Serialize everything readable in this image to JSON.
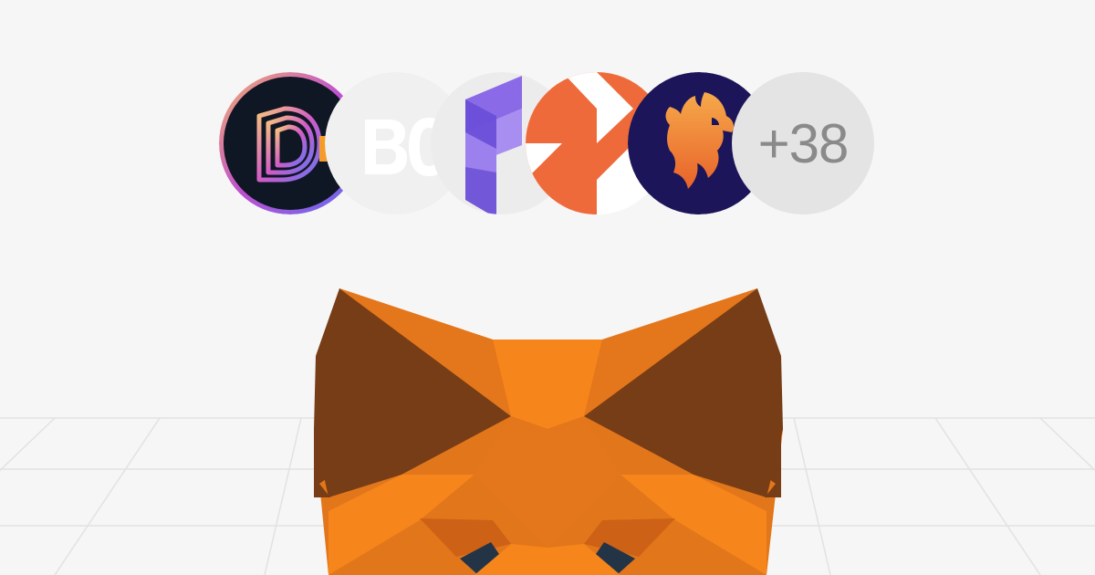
{
  "banner": {
    "avatars": [
      {
        "icon": "layered-d-logo-icon"
      },
      {
        "icon": "bc-text-logo-icon"
      },
      {
        "icon": "purple-f-logo-icon"
      },
      {
        "icon": "orange-geometric-logo-icon"
      },
      {
        "icon": "phoenix-lion-logo-icon"
      }
    ],
    "more_count": "+38",
    "mascot": "metamask-fox-icon",
    "colors": {
      "background": "#f6f6f6",
      "fox_orange": "#f6851b",
      "fox_brown": "#763d16",
      "purple": "#7b5de3",
      "coral": "#ef6a3b",
      "navy": "#1c1559"
    }
  }
}
